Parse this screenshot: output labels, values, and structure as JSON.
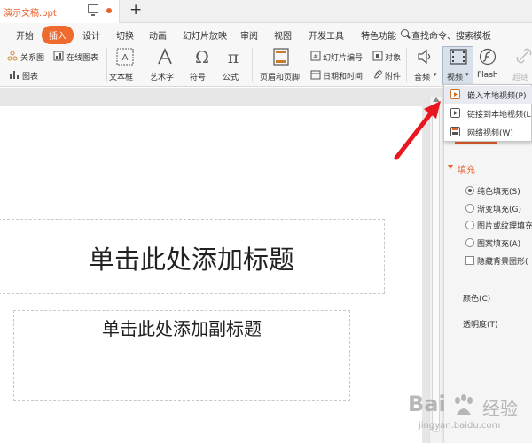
{
  "titlebar": {
    "doc_title": "演示文稿.ppt"
  },
  "menubar": {
    "items": [
      "开始",
      "插入",
      "设计",
      "切换",
      "动画",
      "幻灯片放映",
      "审阅",
      "视图",
      "开发工具",
      "特色功能"
    ],
    "active": "插入",
    "search_label": "查找命令、搜索模板"
  },
  "ribbon": {
    "relation_graph": "关系图",
    "online_chart": "在线图表",
    "chart": "图表",
    "textbox": "文本框",
    "art_text": "艺术字",
    "symbol": "符号",
    "formula": "公式",
    "header_footer": "页眉和页脚",
    "slide_number": "幻灯片编号",
    "object": "对象",
    "date_time": "日期和时间",
    "attachment": "附件",
    "audio": "音频",
    "video": "视频",
    "flash": "Flash",
    "hyperlink": "超链"
  },
  "video_menu": {
    "items": [
      {
        "label": "嵌入本地视频(P)",
        "icon": "play-icon"
      },
      {
        "label": "链接到本地视频(L",
        "icon": "link-video-icon"
      },
      {
        "label": "网络视频(W)",
        "icon": "web-video-icon"
      }
    ]
  },
  "slide": {
    "title_placeholder": "单击此处添加标题",
    "subtitle_placeholder": "单击此处添加副标题"
  },
  "fill_pane": {
    "section": "填充",
    "options": [
      "纯色填充(S)",
      "渐变填充(G)",
      "图片或纹理填充",
      "图案填充(A)"
    ],
    "selected": "纯色填充(S)",
    "hide_bg": "隐藏背景图形(",
    "color_label": "颜色(C)",
    "transparency_label": "透明度(T)"
  },
  "colors": {
    "accent": "#e8612c",
    "menu_active_bg": "#ee6a2e",
    "annotation_arrow": "#e8161e",
    "video_highlight": "#d8e0ea"
  },
  "watermark": {
    "brand": "Bai",
    "product": "经验",
    "url": "jingyan.baidu.com"
  }
}
